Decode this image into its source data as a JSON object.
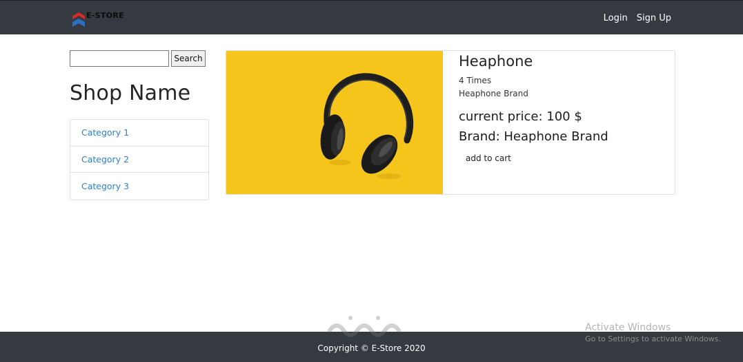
{
  "navbar": {
    "brand_text": "E-STORE",
    "links": [
      "Login",
      "Sign Up"
    ]
  },
  "sidebar": {
    "search_placeholder": "",
    "search_button": "Search",
    "shop_name": "Shop Name",
    "categories": [
      "Category 1",
      "Category 2",
      "Category 3"
    ]
  },
  "product": {
    "title": "Heaphone",
    "times": "4 Times",
    "brand_small": "Heaphone Brand",
    "price_line": "current price: 100 $",
    "brand_line": "Brand: Heaphone Brand",
    "add_to_cart": "add to cart"
  },
  "footer": {
    "copyright": "Copyright © E-Store 2020"
  },
  "watermark": {
    "activate_title": "Activate Windows",
    "activate_sub": "Go to Settings to activate Windows."
  },
  "colors": {
    "navbar_bg": "#343a40",
    "link_blue": "#2f7fc9",
    "image_yellow": "#f5c51c",
    "logo_red": "#d42a2a",
    "logo_blue": "#2f6fc1"
  }
}
